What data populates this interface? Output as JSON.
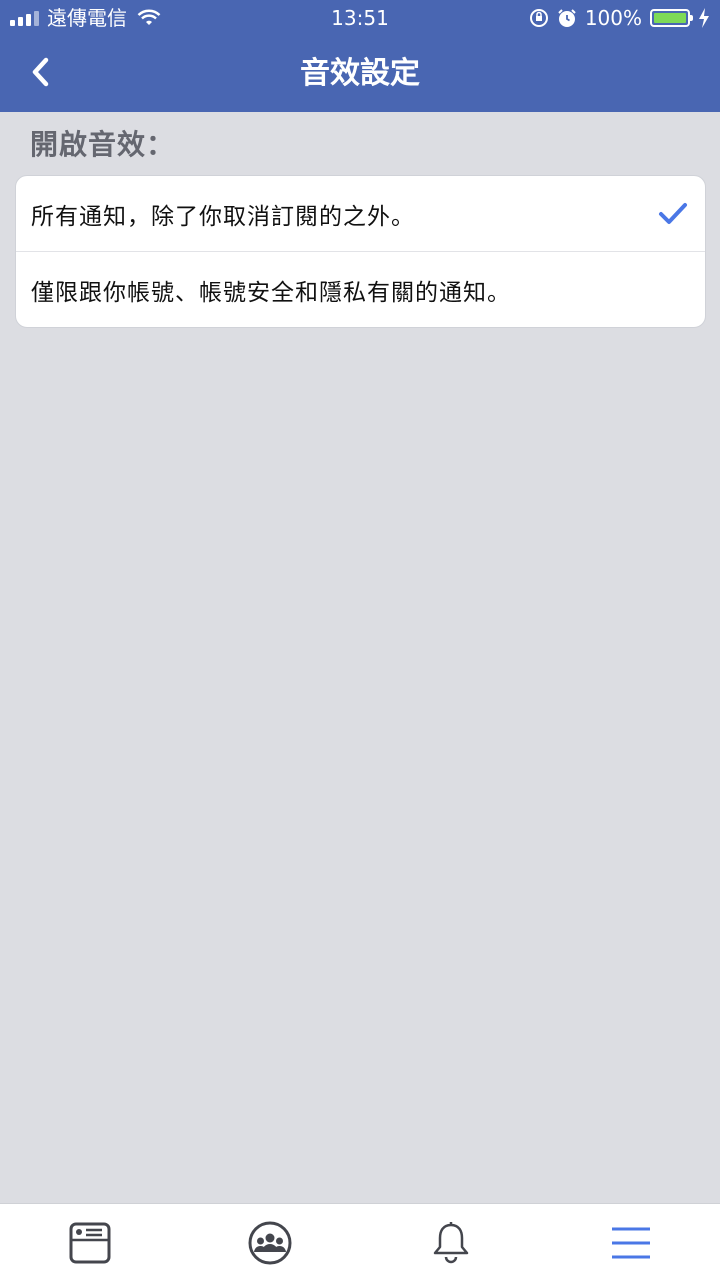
{
  "status_bar": {
    "carrier": "遠傳電信",
    "time": "13:51",
    "battery_percent": "100%",
    "battery_color": "#7ed957"
  },
  "nav": {
    "title": "音效設定",
    "back_icon": "chevron-left-icon"
  },
  "section": {
    "title": "開啟音效："
  },
  "options": [
    {
      "label": "所有通知，除了你取消訂閱的之外。",
      "selected": true
    },
    {
      "label": "僅限跟你帳號、帳號安全和隱私有關的通知。",
      "selected": false
    }
  ],
  "tabbar": {
    "items": [
      {
        "icon": "news-feed-icon",
        "active": false
      },
      {
        "icon": "groups-icon",
        "active": false
      },
      {
        "icon": "bell-icon",
        "active": false
      },
      {
        "icon": "menu-icon",
        "active": true
      }
    ]
  },
  "colors": {
    "header": "#4966b2",
    "accent": "#4a77e6",
    "background": "#dcdde2"
  }
}
